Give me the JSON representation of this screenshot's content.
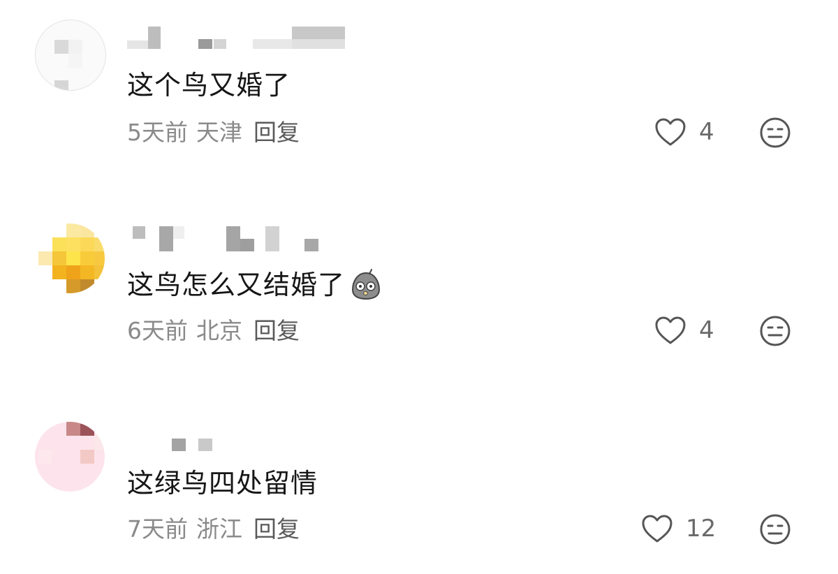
{
  "comments": [
    {
      "text": "这个鸟又婚了",
      "time": "5天前",
      "location": "天津",
      "reply_label": "回复",
      "likes": "4"
    },
    {
      "text": "这鸟怎么又结婚了",
      "time": "6天前",
      "location": "北京",
      "reply_label": "回复",
      "likes": "4",
      "emoji": "surprised-bird-emoji"
    },
    {
      "text": "这绿鸟四处留情",
      "time": "7天前",
      "location": "浙江",
      "reply_label": "回复",
      "likes": "12"
    }
  ],
  "icons": {
    "like": "heart-outline-icon",
    "dislike": "neutral-face-icon"
  },
  "colors": {
    "text": "#161616",
    "meta": "#8a8a8a",
    "icon": "#555555"
  }
}
